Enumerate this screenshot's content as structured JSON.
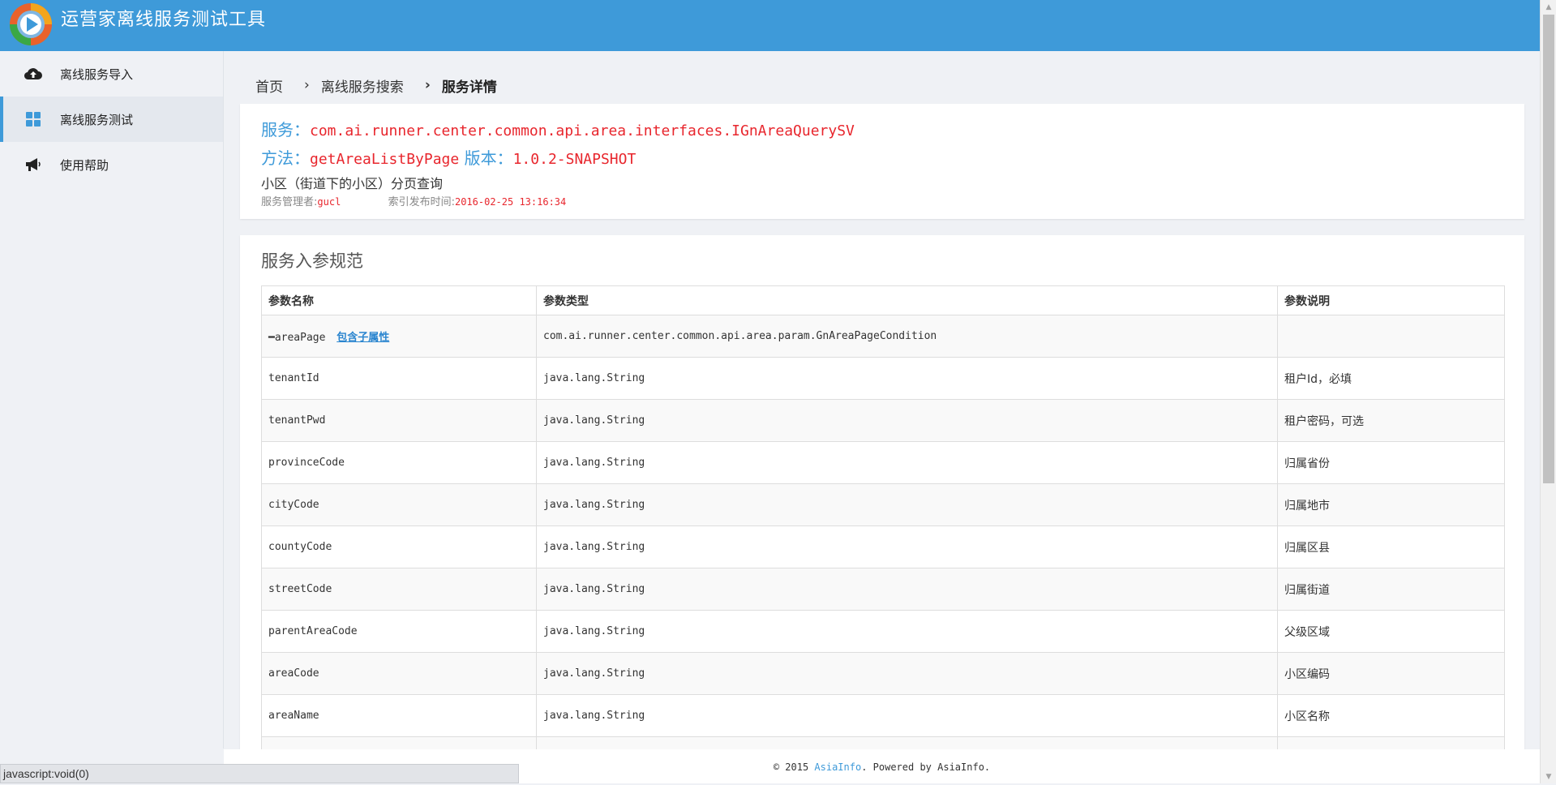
{
  "header": {
    "title": "运营家离线服务测试工具"
  },
  "sidebar": {
    "items": [
      {
        "label": "离线服务导入",
        "icon": "cloud-upload-icon",
        "active": false
      },
      {
        "label": "离线服务测试",
        "icon": "grid-icon",
        "active": true
      },
      {
        "label": "使用帮助",
        "icon": "megaphone-icon",
        "active": false
      }
    ]
  },
  "breadcrumb": {
    "items": [
      "首页",
      "离线服务搜索",
      "服务详情"
    ],
    "separator": "›"
  },
  "service": {
    "service_label": "服务：",
    "service_value": "com.ai.runner.center.common.api.area.interfaces.IGnAreaQuerySV",
    "method_label": "方法：",
    "method_value": "getAreaListByPage",
    "version_label": "版本：",
    "version_value": "1.0.2-SNAPSHOT",
    "description": "小区（街道下的小区）分页查询",
    "manager_label": "服务管理者:",
    "manager_value": "gucl",
    "publish_label": "索引发布时间:",
    "publish_value": "2016-02-25 13:16:34"
  },
  "params": {
    "title": "服务入参规范",
    "columns": [
      "参数名称",
      "参数类型",
      "参数说明"
    ],
    "root": {
      "toggle": "━",
      "name": "areaPage",
      "link": "包含子属性",
      "type": "com.ai.runner.center.common.api.area.param.GnAreaPageCondition",
      "desc": ""
    },
    "rows": [
      {
        "name": "tenantId",
        "type": "java.lang.String",
        "desc": "租户Id，必填"
      },
      {
        "name": "tenantPwd",
        "type": "java.lang.String",
        "desc": "租户密码，可选"
      },
      {
        "name": "provinceCode",
        "type": "java.lang.String",
        "desc": "归属省份"
      },
      {
        "name": "cityCode",
        "type": "java.lang.String",
        "desc": "归属地市"
      },
      {
        "name": "countyCode",
        "type": "java.lang.String",
        "desc": "归属区县"
      },
      {
        "name": "streetCode",
        "type": "java.lang.String",
        "desc": "归属街道"
      },
      {
        "name": "parentAreaCode",
        "type": "java.lang.String",
        "desc": "父级区域"
      },
      {
        "name": "areaCode",
        "type": "java.lang.String",
        "desc": "小区编码"
      },
      {
        "name": "areaName",
        "type": "java.lang.String",
        "desc": "小区名称"
      },
      {
        "name": "",
        "type": "",
        "desc": ""
      }
    ]
  },
  "footer": {
    "prefix": "© 2015 ",
    "brand": "AsiaInfo",
    "suffix": ". Powered by AsiaInfo."
  },
  "statusbar": {
    "text": "javascript:void(0)"
  },
  "colors": {
    "brand": "#3e9ad9",
    "value_red": "#e8262d",
    "link": "#2a85cf"
  }
}
